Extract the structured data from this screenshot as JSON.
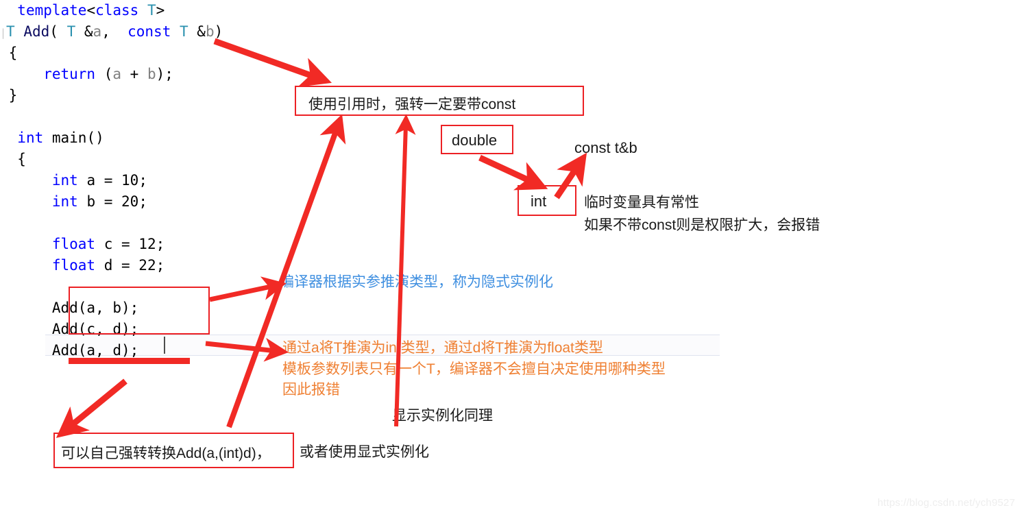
{
  "editor": {
    "lines": [
      [
        {
          "t": "  ",
          "c": "pl"
        },
        {
          "t": "template",
          "c": "kw"
        },
        {
          "t": "<",
          "c": "pl"
        },
        {
          "t": "class",
          "c": "kw"
        },
        {
          "t": " ",
          "c": "pl"
        },
        {
          "t": "T",
          "c": "type"
        },
        {
          "t": ">",
          "c": "pl"
        }
      ],
      [
        {
          "t": "|",
          "c": "mark"
        },
        {
          "t": "T",
          "c": "type"
        },
        {
          "t": " ",
          "c": "pl"
        },
        {
          "t": "Add",
          "c": "fn"
        },
        {
          "t": "( ",
          "c": "pl"
        },
        {
          "t": "T",
          "c": "type"
        },
        {
          "t": " &",
          "c": "pl"
        },
        {
          "t": "a",
          "c": "var"
        },
        {
          "t": ",  ",
          "c": "pl"
        },
        {
          "t": "const",
          "c": "kw"
        },
        {
          "t": " ",
          "c": "pl"
        },
        {
          "t": "T",
          "c": "type"
        },
        {
          "t": " &",
          "c": "pl"
        },
        {
          "t": "b",
          "c": "var"
        },
        {
          "t": ")",
          "c": "pl"
        }
      ],
      [
        {
          "t": " {",
          "c": "pl"
        }
      ],
      [
        {
          "t": "     ",
          "c": "pl"
        },
        {
          "t": "return",
          "c": "kw"
        },
        {
          "t": " (",
          "c": "pl"
        },
        {
          "t": "a",
          "c": "var"
        },
        {
          "t": " + ",
          "c": "pl"
        },
        {
          "t": "b",
          "c": "var"
        },
        {
          "t": ");",
          "c": "pl"
        }
      ],
      [
        {
          "t": " }",
          "c": "pl"
        }
      ],
      [
        {
          "t": "",
          "c": "pl"
        }
      ],
      [
        {
          "t": "  ",
          "c": "pl"
        },
        {
          "t": "int",
          "c": "kw"
        },
        {
          "t": " main()",
          "c": "pl"
        }
      ],
      [
        {
          "t": "  {",
          "c": "pl"
        }
      ],
      [
        {
          "t": "      ",
          "c": "pl"
        },
        {
          "t": "int",
          "c": "kw"
        },
        {
          "t": " a = ",
          "c": "pl"
        },
        {
          "t": "10",
          "c": "pl"
        },
        {
          "t": ";",
          "c": "pl"
        }
      ],
      [
        {
          "t": "      ",
          "c": "pl"
        },
        {
          "t": "int",
          "c": "kw"
        },
        {
          "t": " b = ",
          "c": "pl"
        },
        {
          "t": "20",
          "c": "pl"
        },
        {
          "t": ";",
          "c": "pl"
        }
      ],
      [
        {
          "t": "",
          "c": "pl"
        }
      ],
      [
        {
          "t": "      ",
          "c": "pl"
        },
        {
          "t": "float",
          "c": "kw"
        },
        {
          "t": " c = ",
          "c": "pl"
        },
        {
          "t": "12",
          "c": "pl"
        },
        {
          "t": ";",
          "c": "pl"
        }
      ],
      [
        {
          "t": "      ",
          "c": "pl"
        },
        {
          "t": "float",
          "c": "kw"
        },
        {
          "t": " d = ",
          "c": "pl"
        },
        {
          "t": "22",
          "c": "pl"
        },
        {
          "t": ";",
          "c": "pl"
        }
      ],
      [
        {
          "t": "",
          "c": "pl"
        }
      ],
      [
        {
          "t": "      Add(a, b);",
          "c": "pl"
        }
      ],
      [
        {
          "t": "      Add(c, d);",
          "c": "pl"
        }
      ],
      [
        {
          "t": "      Add(a, d);",
          "c": "pl"
        }
      ]
    ],
    "plain_source": "template<class T>\nT Add( T &a,  const T &b)\n{\n    return (a + b);\n}\n\nint main()\n{\n    int a = 10;\n    int b = 20;\n\n    float c = 12;\n    float d = 22;\n\n    Add(a, b);\n    Add(c, d);\n    Add(a, d);"
  },
  "annotations": {
    "box_const_note": "使用引用时，强转一定要带const",
    "box_double": "double",
    "box_int": "int",
    "text_const_tb": "const t&b",
    "text_temp_var_line1": "临时变量具有常性",
    "text_temp_var_line2": "如果不带const则是权限扩大，会报错",
    "text_implicit": "编译器根据实参推演类型，称为隐式实例化",
    "text_deduce_line1": "通过a将T推演为int类型，通过d将T推演为float类型",
    "text_deduce_line2": "模板参数列表只有一个T，编译器不会擅自决定使用哪种类型",
    "text_deduce_line3": "因此报错",
    "text_explicit_same": "显示实例化同理",
    "box_cast_note": "可以自己强转转换Add(a,(int)d)，",
    "text_or_explicit": "或者使用显式实例化"
  },
  "colors": {
    "annotation_red": "#ec2024",
    "arrow_red": "#f12a25",
    "note_blue": "#3f8fe0",
    "note_orange": "#ef8033",
    "keyword_blue": "#0000ff",
    "type_teal": "#2b91af",
    "identifier_gray": "#808080"
  },
  "watermark": {
    "text": "https://blog.csdn.net/ych9527"
  }
}
